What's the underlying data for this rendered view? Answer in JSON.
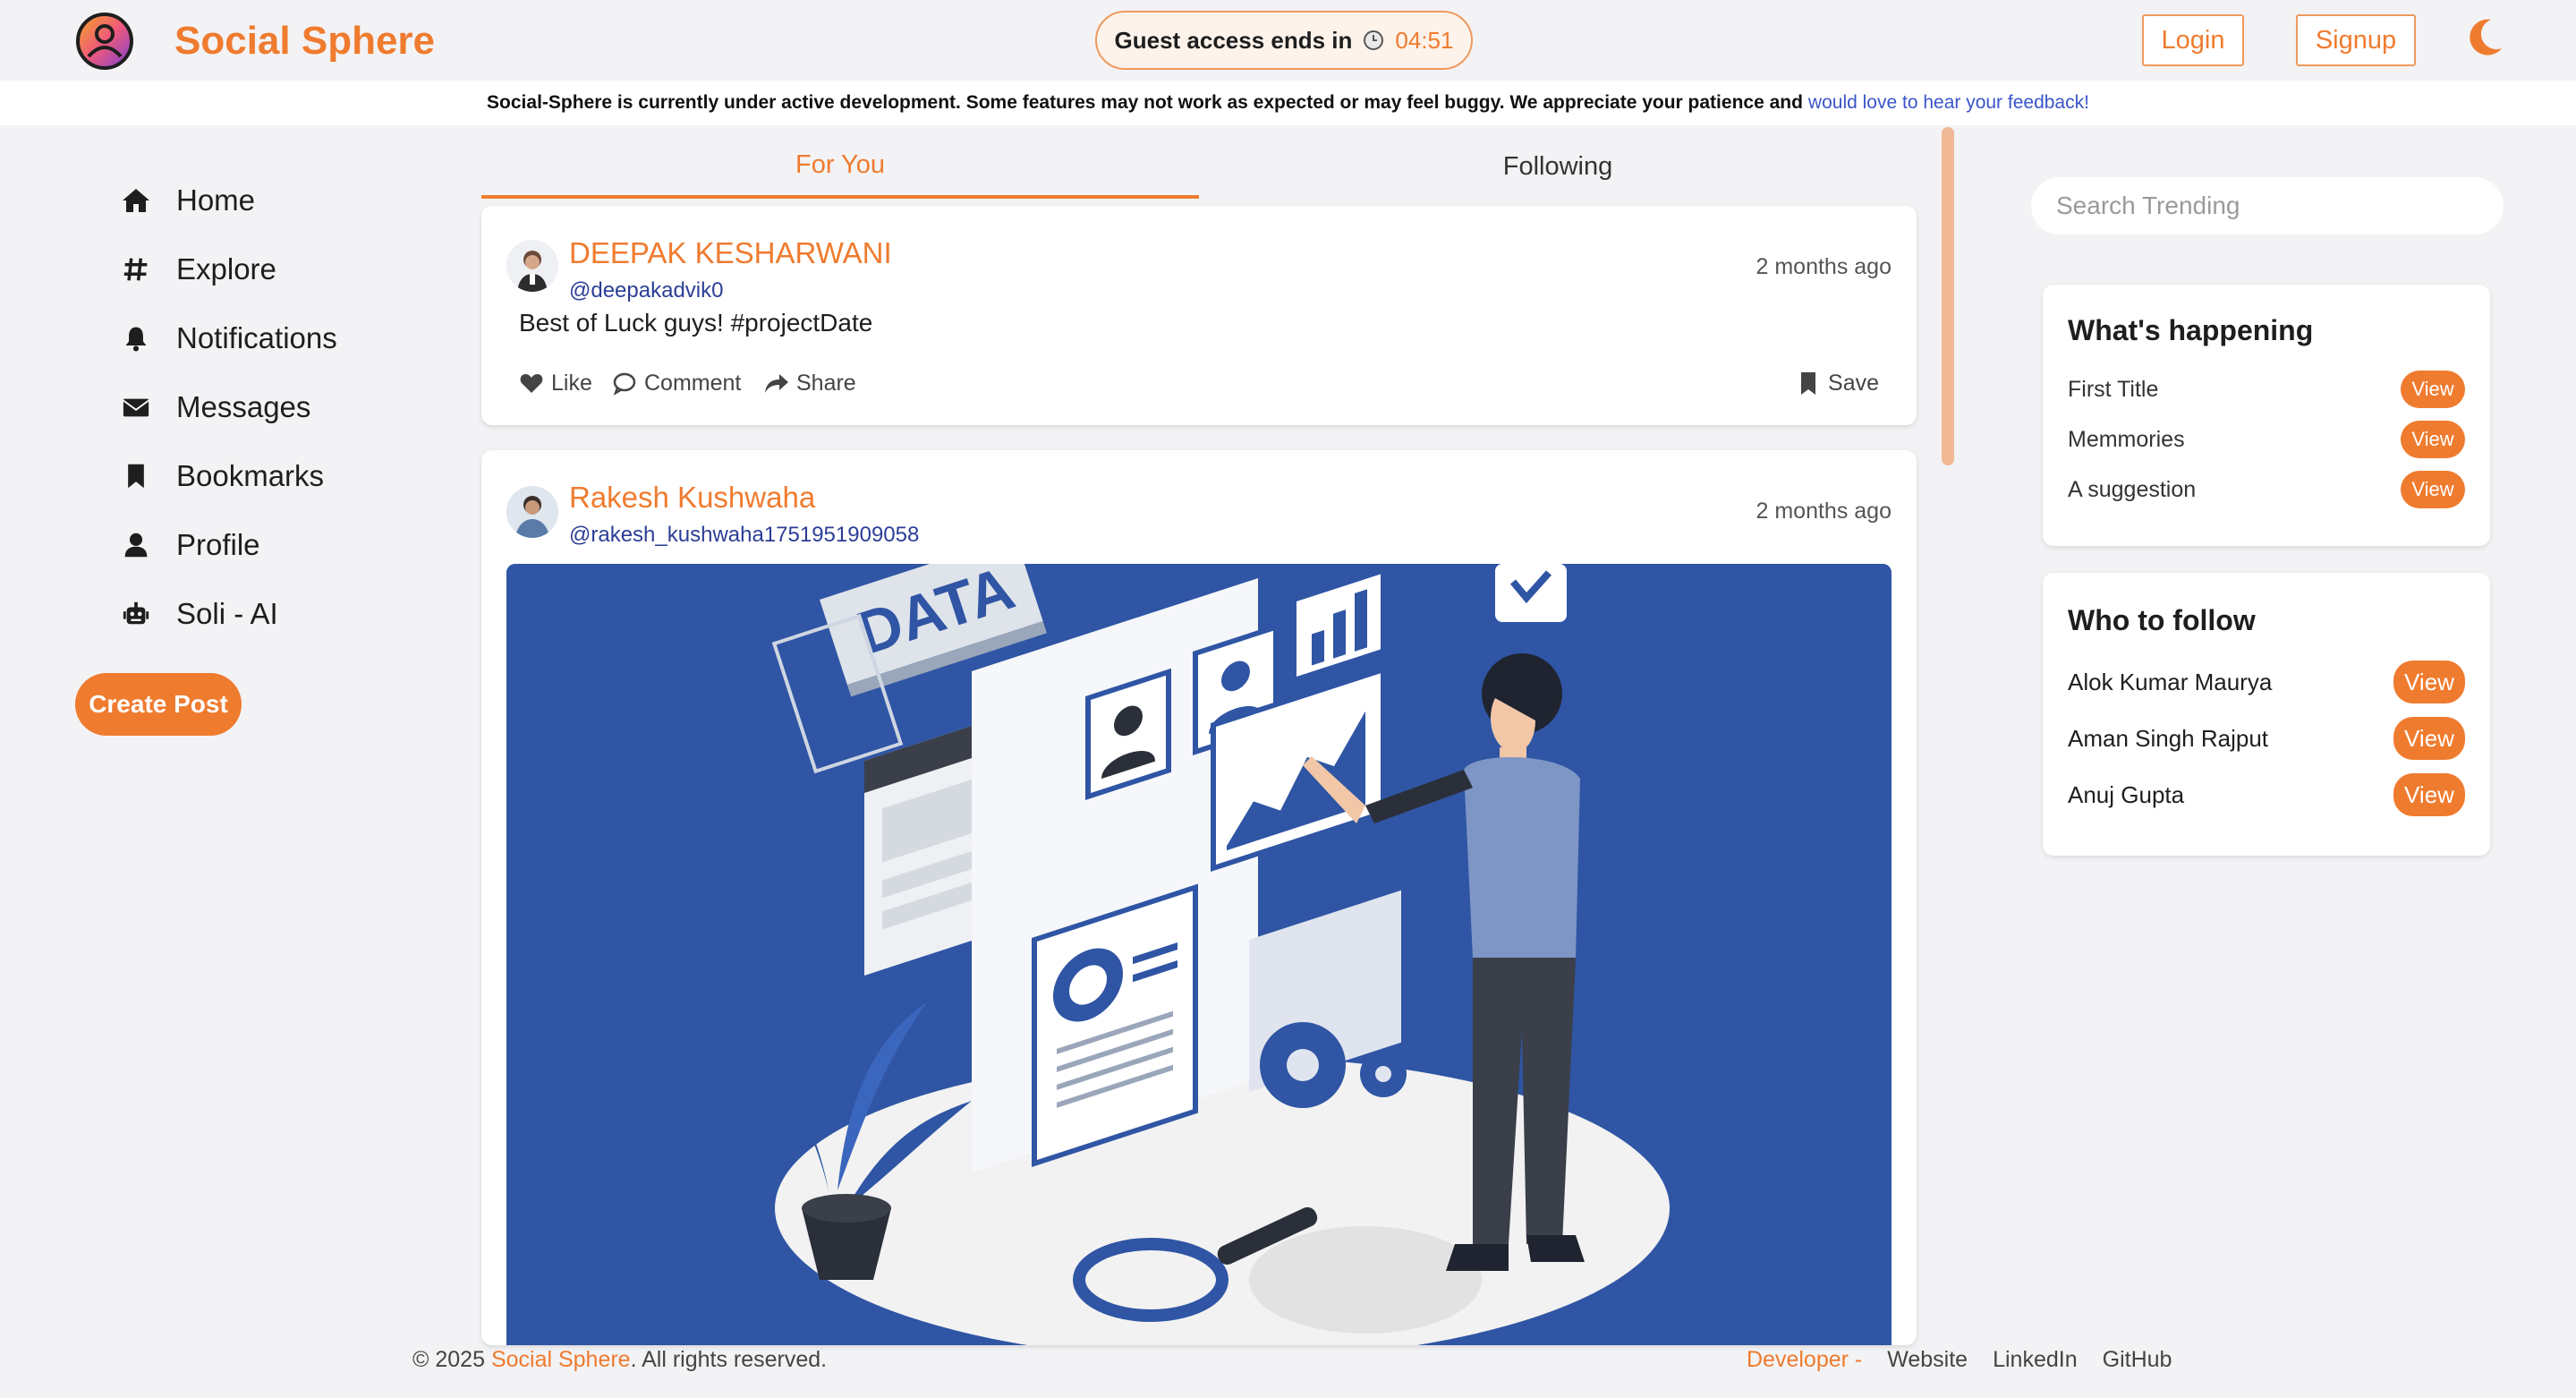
{
  "header": {
    "brand": "Social Sphere",
    "guest_text": "Guest access ends in",
    "guest_time": "04:51",
    "login_label": "Login",
    "signup_label": "Signup"
  },
  "notice": {
    "text": "Social-Sphere is currently under active development. Some features may not work as expected or may feel buggy. We appreciate your patience and",
    "link": "would love to hear your feedback!"
  },
  "sidebar": {
    "items": [
      {
        "label": "Home",
        "icon": "home-icon"
      },
      {
        "label": "Explore",
        "icon": "hashtag-icon"
      },
      {
        "label": "Notifications",
        "icon": "bell-icon"
      },
      {
        "label": "Messages",
        "icon": "envelope-icon"
      },
      {
        "label": "Bookmarks",
        "icon": "bookmark-icon"
      },
      {
        "label": "Profile",
        "icon": "user-icon"
      },
      {
        "label": "Soli - AI",
        "icon": "robot-icon"
      }
    ],
    "create_post": "Create Post"
  },
  "feed": {
    "tabs": [
      "For You",
      "Following"
    ],
    "posts": [
      {
        "author": "DEEPAK KESHARWANI",
        "handle": "@deepakadvik0",
        "time": "2 months ago",
        "text": "Best of Luck guys! #projectDate",
        "actions": {
          "like": "Like",
          "comment": "Comment",
          "share": "Share",
          "save": "Save"
        }
      },
      {
        "author": "Rakesh Kushwaha",
        "handle": "@rakesh_kushwaha1751951909058",
        "time": "2 months ago",
        "image_caption": "DATA"
      }
    ]
  },
  "right": {
    "search_placeholder": "Search Trending",
    "whats_happening": {
      "title": "What's happening",
      "items": [
        "First Title",
        "Memmories",
        "A suggestion"
      ],
      "view_label": "View"
    },
    "who_to_follow": {
      "title": "Who to follow",
      "items": [
        "Alok Kumar Maurya",
        "Aman Singh Rajput",
        "Anuj Gupta"
      ],
      "view_label": "View"
    }
  },
  "footer": {
    "copyright": "© 2025",
    "brand": "Social Sphere",
    "rights": ". All rights reserved.",
    "developer": "Developer -",
    "links": [
      "Website",
      "LinkedIn",
      "GitHub"
    ]
  },
  "colors": {
    "accent": "#ef7b2f",
    "handle": "#2c3e96",
    "link": "#3a55c8",
    "illustration_bg": "#2f55a4"
  }
}
